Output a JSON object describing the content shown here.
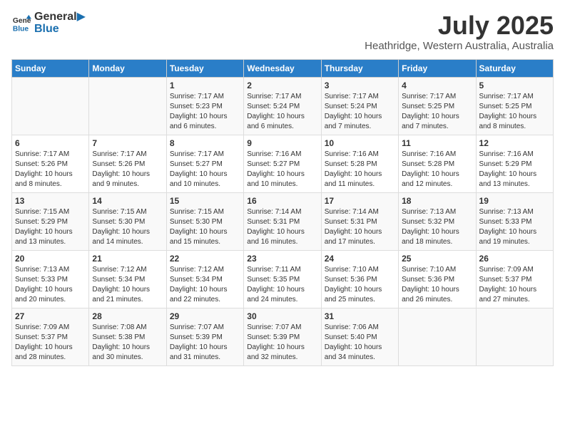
{
  "header": {
    "logo_general": "General",
    "logo_blue": "Blue",
    "month": "July 2025",
    "location": "Heathridge, Western Australia, Australia"
  },
  "calendar": {
    "days_of_week": [
      "Sunday",
      "Monday",
      "Tuesday",
      "Wednesday",
      "Thursday",
      "Friday",
      "Saturday"
    ],
    "weeks": [
      [
        {
          "day": "",
          "info": ""
        },
        {
          "day": "",
          "info": ""
        },
        {
          "day": "1",
          "info": "Sunrise: 7:17 AM\nSunset: 5:23 PM\nDaylight: 10 hours\nand 6 minutes."
        },
        {
          "day": "2",
          "info": "Sunrise: 7:17 AM\nSunset: 5:24 PM\nDaylight: 10 hours\nand 6 minutes."
        },
        {
          "day": "3",
          "info": "Sunrise: 7:17 AM\nSunset: 5:24 PM\nDaylight: 10 hours\nand 7 minutes."
        },
        {
          "day": "4",
          "info": "Sunrise: 7:17 AM\nSunset: 5:25 PM\nDaylight: 10 hours\nand 7 minutes."
        },
        {
          "day": "5",
          "info": "Sunrise: 7:17 AM\nSunset: 5:25 PM\nDaylight: 10 hours\nand 8 minutes."
        }
      ],
      [
        {
          "day": "6",
          "info": "Sunrise: 7:17 AM\nSunset: 5:26 PM\nDaylight: 10 hours\nand 8 minutes."
        },
        {
          "day": "7",
          "info": "Sunrise: 7:17 AM\nSunset: 5:26 PM\nDaylight: 10 hours\nand 9 minutes."
        },
        {
          "day": "8",
          "info": "Sunrise: 7:17 AM\nSunset: 5:27 PM\nDaylight: 10 hours\nand 10 minutes."
        },
        {
          "day": "9",
          "info": "Sunrise: 7:16 AM\nSunset: 5:27 PM\nDaylight: 10 hours\nand 10 minutes."
        },
        {
          "day": "10",
          "info": "Sunrise: 7:16 AM\nSunset: 5:28 PM\nDaylight: 10 hours\nand 11 minutes."
        },
        {
          "day": "11",
          "info": "Sunrise: 7:16 AM\nSunset: 5:28 PM\nDaylight: 10 hours\nand 12 minutes."
        },
        {
          "day": "12",
          "info": "Sunrise: 7:16 AM\nSunset: 5:29 PM\nDaylight: 10 hours\nand 13 minutes."
        }
      ],
      [
        {
          "day": "13",
          "info": "Sunrise: 7:15 AM\nSunset: 5:29 PM\nDaylight: 10 hours\nand 13 minutes."
        },
        {
          "day": "14",
          "info": "Sunrise: 7:15 AM\nSunset: 5:30 PM\nDaylight: 10 hours\nand 14 minutes."
        },
        {
          "day": "15",
          "info": "Sunrise: 7:15 AM\nSunset: 5:30 PM\nDaylight: 10 hours\nand 15 minutes."
        },
        {
          "day": "16",
          "info": "Sunrise: 7:14 AM\nSunset: 5:31 PM\nDaylight: 10 hours\nand 16 minutes."
        },
        {
          "day": "17",
          "info": "Sunrise: 7:14 AM\nSunset: 5:31 PM\nDaylight: 10 hours\nand 17 minutes."
        },
        {
          "day": "18",
          "info": "Sunrise: 7:13 AM\nSunset: 5:32 PM\nDaylight: 10 hours\nand 18 minutes."
        },
        {
          "day": "19",
          "info": "Sunrise: 7:13 AM\nSunset: 5:33 PM\nDaylight: 10 hours\nand 19 minutes."
        }
      ],
      [
        {
          "day": "20",
          "info": "Sunrise: 7:13 AM\nSunset: 5:33 PM\nDaylight: 10 hours\nand 20 minutes."
        },
        {
          "day": "21",
          "info": "Sunrise: 7:12 AM\nSunset: 5:34 PM\nDaylight: 10 hours\nand 21 minutes."
        },
        {
          "day": "22",
          "info": "Sunrise: 7:12 AM\nSunset: 5:34 PM\nDaylight: 10 hours\nand 22 minutes."
        },
        {
          "day": "23",
          "info": "Sunrise: 7:11 AM\nSunset: 5:35 PM\nDaylight: 10 hours\nand 24 minutes."
        },
        {
          "day": "24",
          "info": "Sunrise: 7:10 AM\nSunset: 5:36 PM\nDaylight: 10 hours\nand 25 minutes."
        },
        {
          "day": "25",
          "info": "Sunrise: 7:10 AM\nSunset: 5:36 PM\nDaylight: 10 hours\nand 26 minutes."
        },
        {
          "day": "26",
          "info": "Sunrise: 7:09 AM\nSunset: 5:37 PM\nDaylight: 10 hours\nand 27 minutes."
        }
      ],
      [
        {
          "day": "27",
          "info": "Sunrise: 7:09 AM\nSunset: 5:37 PM\nDaylight: 10 hours\nand 28 minutes."
        },
        {
          "day": "28",
          "info": "Sunrise: 7:08 AM\nSunset: 5:38 PM\nDaylight: 10 hours\nand 30 minutes."
        },
        {
          "day": "29",
          "info": "Sunrise: 7:07 AM\nSunset: 5:39 PM\nDaylight: 10 hours\nand 31 minutes."
        },
        {
          "day": "30",
          "info": "Sunrise: 7:07 AM\nSunset: 5:39 PM\nDaylight: 10 hours\nand 32 minutes."
        },
        {
          "day": "31",
          "info": "Sunrise: 7:06 AM\nSunset: 5:40 PM\nDaylight: 10 hours\nand 34 minutes."
        },
        {
          "day": "",
          "info": ""
        },
        {
          "day": "",
          "info": ""
        }
      ]
    ]
  }
}
